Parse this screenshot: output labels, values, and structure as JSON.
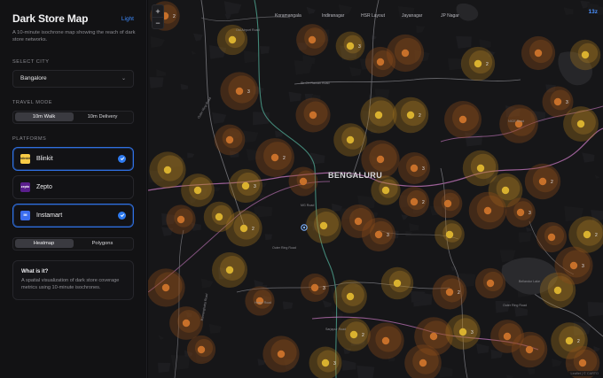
{
  "sidebar": {
    "title": "Dark Store Map",
    "theme_toggle": "Light",
    "subtitle": "A 10-minute isochrone map showing the reach of dark store networks.",
    "select_city_label": "SELECT CITY",
    "city_value": "Bangalore",
    "travel_mode_label": "TRAVEL MODE",
    "travel_modes": [
      "10m Walk",
      "10m Delivery"
    ],
    "travel_mode_selected": "10m Walk",
    "platforms_label": "PLATFORMS",
    "platforms": [
      {
        "name": "Blinkit",
        "logo_text": "blinkit",
        "logo_bg": "#f8cb46",
        "logo_fg": "#1a1a1a",
        "selected": true
      },
      {
        "name": "Zepto",
        "logo_text": "zepto",
        "logo_bg": "#5a1e8c",
        "logo_fg": "#ffffff",
        "selected": false
      },
      {
        "name": "Instamart",
        "logo_text": "IM",
        "logo_bg": "#3b6df0",
        "logo_fg": "#ffffff",
        "selected": true
      }
    ],
    "view_modes": [
      "Heatmap",
      "Polygons"
    ],
    "view_mode_selected": "Heatmap",
    "info": {
      "title": "What is it?",
      "text": "A spatial visualization of dark store coverage metrics using 10-minute isochrones."
    }
  },
  "map": {
    "zoom_in": "+",
    "zoom_out": "−",
    "zoom_level": "13z",
    "city_label": "BENGALURU",
    "area_labels": [
      "Koramangala",
      "Indiranagar",
      "HSR Layout",
      "Jayanagar",
      "JP Nagar"
    ],
    "road_labels": [
      "Old Airport Road",
      "Sir CV Raman Road",
      "MG Road",
      "Outer Ring Road",
      "Hosur Road",
      "Bannerghatta Road",
      "Sarjapur Road",
      "Outer Ring Road",
      "Outer Ring Road",
      "NICE Road",
      "Bellandur Lake"
    ],
    "attribution": "Leaflet | © CARTO",
    "colors": {
      "accent": "#3d8bff",
      "blinkit": "#f8cb46",
      "instamart": "#e07a1f",
      "coverage": "#7a5a1a"
    }
  }
}
